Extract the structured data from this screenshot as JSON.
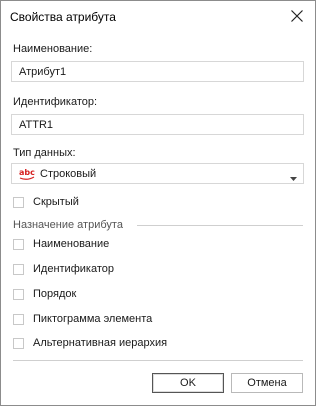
{
  "window": {
    "title": "Свойства атрибута",
    "close_icon": "close-icon"
  },
  "form": {
    "name_label": "Наименование:",
    "name_value": "Атрибут1",
    "id_label": "Идентификатор:",
    "id_value": "ATTR1",
    "datatype_label": "Тип данных:",
    "datatype_value": "Строковый",
    "datatype_icon": "string-type-icon",
    "datatype_icon_text": "abc",
    "hidden_label": "Скрытый",
    "hidden_checked": false
  },
  "purpose": {
    "title": "Назначение атрибута",
    "options": [
      {
        "label": "Наименование",
        "checked": false
      },
      {
        "label": "Идентификатор",
        "checked": false
      },
      {
        "label": "Порядок",
        "checked": false
      },
      {
        "label": "Пиктограмма элемента",
        "checked": false
      },
      {
        "label": "Альтернативная иерархия",
        "checked": false
      }
    ]
  },
  "buttons": {
    "ok": "OK",
    "cancel": "Отмена"
  },
  "colors": {
    "icon_red": "#d62020",
    "border": "#d7d7d7"
  }
}
